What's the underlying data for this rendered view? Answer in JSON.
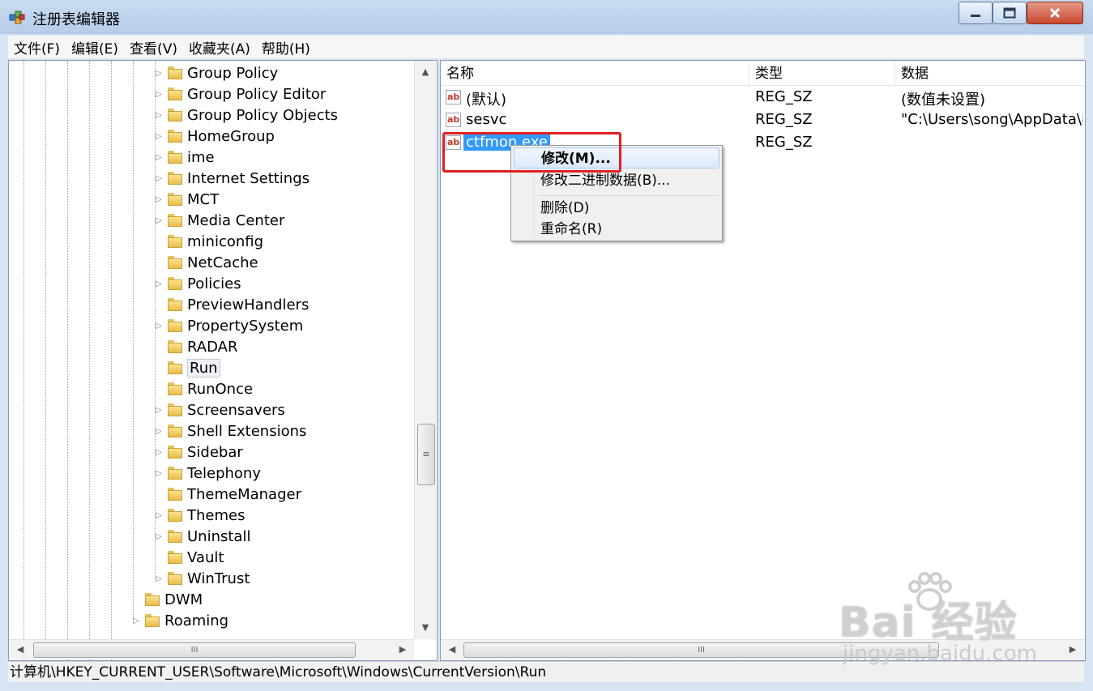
{
  "window": {
    "title": "注册表编辑器"
  },
  "menubar": [
    {
      "label": "文件(F)"
    },
    {
      "label": "编辑(E)"
    },
    {
      "label": "查看(V)"
    },
    {
      "label": "收藏夹(A)"
    },
    {
      "label": "帮助(H)"
    }
  ],
  "tree": {
    "items": [
      {
        "label": "Group Policy"
      },
      {
        "label": "Group Policy Editor"
      },
      {
        "label": "Group Policy Objects"
      },
      {
        "label": "HomeGroup"
      },
      {
        "label": "ime"
      },
      {
        "label": "Internet Settings"
      },
      {
        "label": "MCT"
      },
      {
        "label": "Media Center"
      },
      {
        "label": "miniconfig"
      },
      {
        "label": "NetCache"
      },
      {
        "label": "Policies"
      },
      {
        "label": "PreviewHandlers"
      },
      {
        "label": "PropertySystem"
      },
      {
        "label": "RADAR"
      },
      {
        "label": "Run"
      },
      {
        "label": "RunOnce"
      },
      {
        "label": "Screensavers"
      },
      {
        "label": "Shell Extensions"
      },
      {
        "label": "Sidebar"
      },
      {
        "label": "Telephony"
      },
      {
        "label": "ThemeManager"
      },
      {
        "label": "Themes"
      },
      {
        "label": "Uninstall"
      },
      {
        "label": "Vault"
      },
      {
        "label": "WinTrust"
      },
      {
        "label": "DWM"
      },
      {
        "label": "Roaming"
      }
    ],
    "selected": "Run"
  },
  "list": {
    "columns": [
      "名称",
      "类型",
      "数据"
    ],
    "rows": [
      {
        "name": "(默认)",
        "type": "REG_SZ",
        "data": "(数值未设置)"
      },
      {
        "name": "sesvc",
        "type": "REG_SZ",
        "data": "\"C:\\Users\\song\\AppData\\R"
      },
      {
        "name": "ctfmon.exe",
        "type": "REG_SZ",
        "data": ""
      }
    ],
    "selected": "ctfmon.exe"
  },
  "context_menu": {
    "items": [
      "修改(M)...",
      "修改二进制数据(B)...",
      "删除(D)",
      "重命名(R)"
    ],
    "highlighted": "修改(M)..."
  },
  "statusbar": {
    "path": "计算机\\HKEY_CURRENT_USER\\Software\\Microsoft\\Windows\\CurrentVersion\\Run"
  },
  "watermark": {
    "brand": "Bai  经验",
    "url": "jingyan.baidu.com"
  },
  "colors": {
    "selection": "#3399ff",
    "annotation": "#e02020",
    "folder": "#f0c94e"
  }
}
